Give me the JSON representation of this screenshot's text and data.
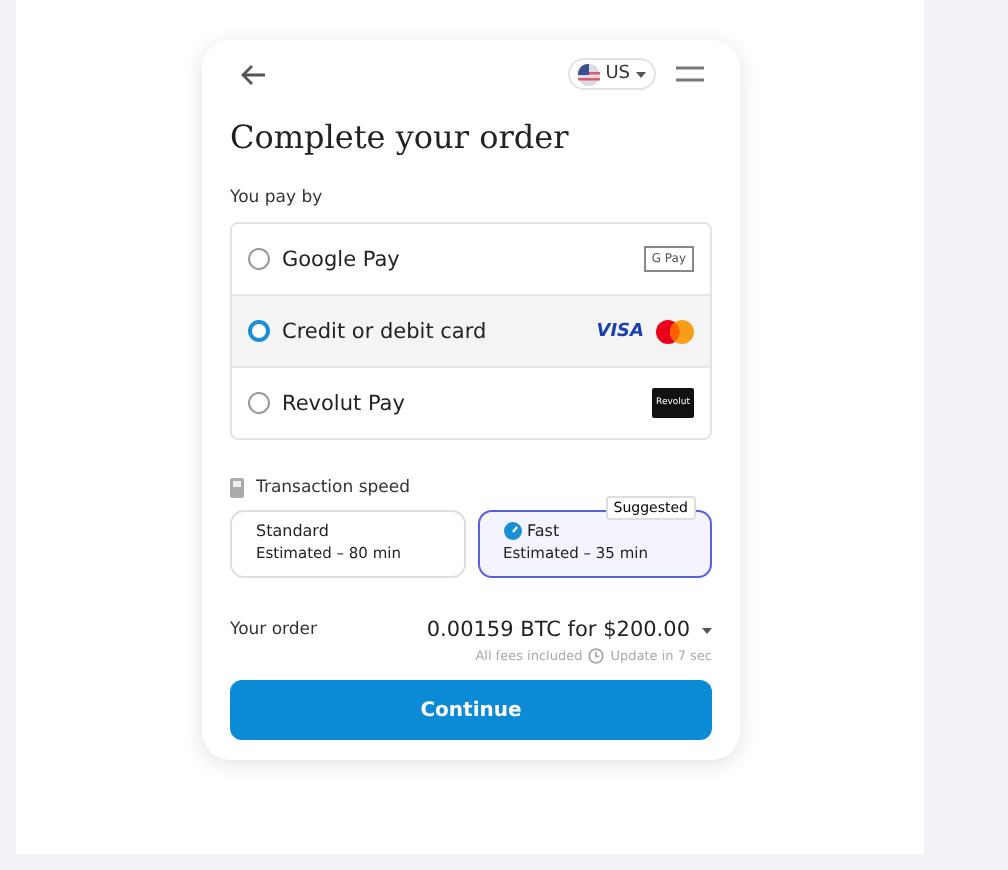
{
  "header": {
    "locale": "US"
  },
  "title": "Complete your order",
  "payment": {
    "label": "You pay by",
    "options": [
      {
        "kind": "gpay",
        "label": "Google Pay",
        "selected": false,
        "logo": "G Pay"
      },
      {
        "kind": "card",
        "label": "Credit or debit card",
        "selected": true,
        "logo": "VISA"
      },
      {
        "kind": "revolut",
        "label": "Revolut Pay",
        "selected": false,
        "logo": "Revolut"
      }
    ]
  },
  "speed": {
    "label": "Transaction speed",
    "options": [
      {
        "name": "Standard",
        "estimate": "Estimated – 80 min",
        "selected": false
      },
      {
        "name": "Fast",
        "estimate": "Estimated – 35 min",
        "selected": true,
        "badge": "Suggested"
      }
    ]
  },
  "order": {
    "label": "Your order",
    "amount": "0.00159 BTC for $200.00",
    "fees": "All fees included",
    "update": "Update in 7 sec"
  },
  "button": "Continue"
}
